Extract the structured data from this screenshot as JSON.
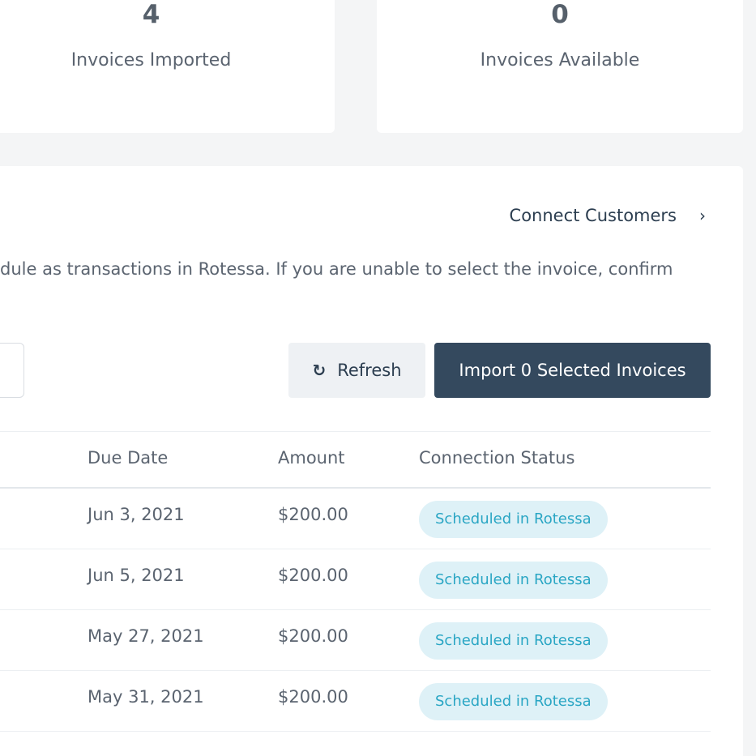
{
  "stats": {
    "imported": {
      "value": "4",
      "label": "Invoices Imported"
    },
    "available": {
      "value": "0",
      "label": "Invoices Available"
    }
  },
  "panel": {
    "connect_link": "Connect Customers",
    "description": "dule as transactions in Rotessa. If you are unable to select the invoice, confirm"
  },
  "toolbar": {
    "refresh_label": "Refresh",
    "import_label": "Import 0 Selected Invoices"
  },
  "table": {
    "headers": {
      "due_date": "Due Date",
      "amount": "Amount",
      "status": "Connection Status"
    },
    "rows": [
      {
        "due_date": "Jun 3, 2021",
        "amount": "$200.00",
        "status": "Scheduled in Rotessa"
      },
      {
        "due_date": "Jun 5, 2021",
        "amount": "$200.00",
        "status": "Scheduled in Rotessa"
      },
      {
        "due_date": "May 27, 2021",
        "amount": "$200.00",
        "status": "Scheduled in Rotessa"
      },
      {
        "due_date": "May 31, 2021",
        "amount": "$200.00",
        "status": "Scheduled in Rotessa"
      }
    ]
  },
  "colors": {
    "primary_button": "#34495e",
    "badge_bg": "#def1f7",
    "badge_text": "#2aa6c4"
  },
  "icons": {
    "refresh": "refresh-icon",
    "chevron": "chevron-right-icon"
  }
}
